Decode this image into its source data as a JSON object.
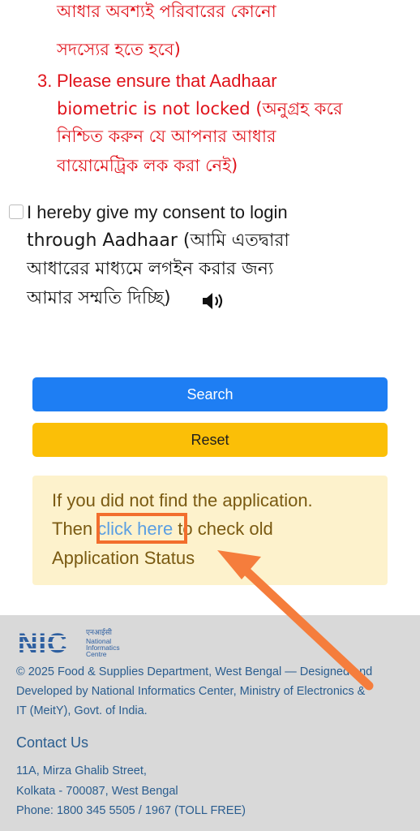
{
  "notes": {
    "line_a": "আধার অবশ্যই পরিবারের কোনো",
    "line_b": "সদস্যের হতে হবে)",
    "item3_number": "3.",
    "item3_line1": "Please ensure that Aadhaar",
    "item3_line2": "biometric is not locked (অনুগ্রহ করে",
    "item3_line3": "নিশ্চিত করুন যে আপনার আধার",
    "item3_line4": "বায়োমেট্রিক লক করা নেই)"
  },
  "consent": {
    "line1": "I hereby give my consent to login",
    "line2": "through Aadhaar (আমি এতদ্বারা",
    "line3": "আধারের মাধ্যমে লগইন করার জন্য",
    "line4": "আমার সম্মতি দিচ্ছি)",
    "checked": false,
    "icon": "speaker-icon"
  },
  "buttons": {
    "search_label": "Search",
    "reset_label": "Reset"
  },
  "alert": {
    "line1": "If you did not find the application.",
    "line2_before": "Then ",
    "link_text": "click here",
    "line2_after": " to check old",
    "line3": "Application Status"
  },
  "footer": {
    "logo_main": "NIC",
    "logo_hindi": "एनआईसी",
    "logo_line1": "National",
    "logo_line2": "Informatics",
    "logo_line3": "Centre",
    "copyright_line1": "© 2025 Food & Supplies Department, West Bengal — Designed and",
    "copyright_line2": "Developed by National Informatics Center, Ministry of Electronics &",
    "copyright_line3": "IT (MeitY), Govt. of India.",
    "contact_title": "Contact Us",
    "address_line1": "11A, Mirza Ghalib Street,",
    "address_line2": "Kolkata - 700087, West Bengal",
    "phone": "Phone: 1800 345 5505 / 1967 (TOLL FREE)"
  },
  "colors": {
    "note_red": "#e0131b",
    "search_blue": "#1e7ef3",
    "reset_yellow": "#fbbf07",
    "alert_bg": "#fdf2cc",
    "annotation_orange": "#f26e2d",
    "footer_bg": "#d9d9d9",
    "footer_text": "#2a5d8f"
  }
}
